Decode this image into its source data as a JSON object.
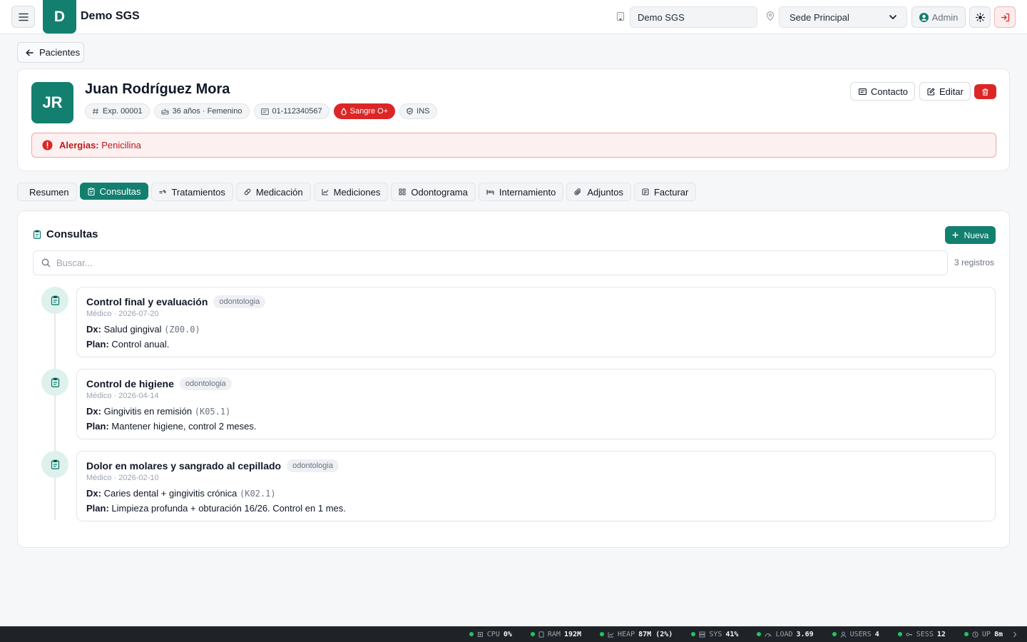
{
  "header": {
    "logo_letter": "D",
    "app_title": "Demo SGS",
    "org_value": "Demo SGS",
    "site_selected": "Sede Principal",
    "user_label": "Admin"
  },
  "back_button": "Pacientes",
  "patient": {
    "initials": "JR",
    "name": "Juan Rodríguez Mora",
    "chips": {
      "record": "Exp. 00001",
      "age_sex": "36 años · Femenino",
      "id_number": "01-112340567",
      "blood": "Sangre O+",
      "insurance": "INS"
    },
    "actions": {
      "contact": "Contacto",
      "edit": "Editar"
    },
    "allergy_label": "Alergias:",
    "allergy_value": "Penicilina"
  },
  "tabs": [
    {
      "label": "Resumen",
      "icon": "none"
    },
    {
      "label": "Consultas",
      "icon": "clipboard-icon",
      "active": true
    },
    {
      "label": "Tratamientos",
      "icon": "pills-icon"
    },
    {
      "label": "Medicación",
      "icon": "capsule-icon"
    },
    {
      "label": "Mediciones",
      "icon": "chart-line-icon"
    },
    {
      "label": "Odontograma",
      "icon": "grid-icon"
    },
    {
      "label": "Internamiento",
      "icon": "bed-icon"
    },
    {
      "label": "Adjuntos",
      "icon": "paperclip-icon"
    },
    {
      "label": "Facturar",
      "icon": "receipt-icon"
    }
  ],
  "consultas": {
    "title": "Consultas",
    "new_button": "Nueva",
    "search_placeholder": "Buscar...",
    "count": "3 registros",
    "dx_label": "Dx:",
    "plan_label": "Plan:",
    "entries": [
      {
        "title": "Control final y evaluación",
        "tag": "odontologia",
        "meta": "Médico · 2026-07-20",
        "dx": "Salud gingival",
        "code": "(Z00.0)",
        "plan": "Control anual."
      },
      {
        "title": "Control de higiene",
        "tag": "odontologia",
        "meta": "Médico · 2026-04-14",
        "dx": "Gingivitis en remisión",
        "code": "(K05.1)",
        "plan": "Mantener higiene, control 2 meses."
      },
      {
        "title": "Dolor en molares y sangrado al cepillado",
        "tag": "odontologia",
        "meta": "Médico · 2026-02-10",
        "dx": "Caries dental + gingivitis crónica",
        "code": "(K02.1)",
        "plan": "Limpieza profunda + obturación 16/26. Control en 1 mes."
      }
    ]
  },
  "status_bar": [
    {
      "label": "CPU",
      "value": "0%"
    },
    {
      "label": "RAM",
      "value": "192M"
    },
    {
      "label": "HEAP",
      "value": "87M (2%)"
    },
    {
      "label": "SYS",
      "value": "41%"
    },
    {
      "label": "LOAD",
      "value": "3.69"
    },
    {
      "label": "USERS",
      "value": "4"
    },
    {
      "label": "SESS",
      "value": "12"
    },
    {
      "label": "UP",
      "value": "8m"
    }
  ],
  "colors": {
    "primary": "#137f6f",
    "danger": "#dc2626",
    "status_ok": "#22c55e"
  }
}
